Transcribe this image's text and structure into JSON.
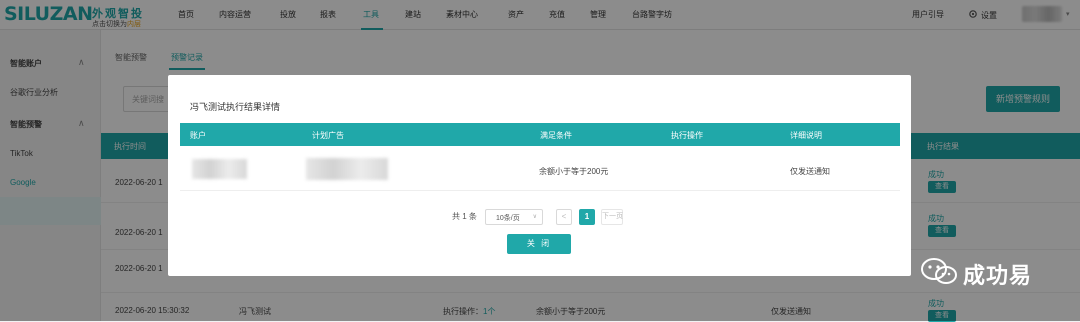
{
  "brand": {
    "logo": "SILUZAN",
    "logo_cn": "外观智投",
    "sub_prefix": "点击切换为",
    "sub_highlight": "内层"
  },
  "nav": {
    "items": [
      "首页",
      "内容运营",
      "投放",
      "报表",
      "工具",
      "建站",
      "素材中心",
      "资产",
      "充值",
      "管理",
      "台路警字坊"
    ],
    "active_index": 4
  },
  "top_right": {
    "guide": "用户引导",
    "settings": "设置"
  },
  "sidebar": {
    "items": [
      {
        "label": "智能账户",
        "group": true,
        "caret": "∧"
      },
      {
        "label": "谷歌行业分析",
        "group": false
      },
      {
        "label": "智能预警",
        "group": true,
        "caret": "∧"
      },
      {
        "label": "TikTok",
        "group": false
      },
      {
        "label": "Google",
        "group": false,
        "active": true
      }
    ]
  },
  "subtabs": {
    "items": [
      "智能预警",
      "预警记录"
    ],
    "active_index": 1
  },
  "search": {
    "placeholder": "关键词搜"
  },
  "new_rule_button": "新增预警规则",
  "bg_table": {
    "headers": [
      "执行时间",
      "执行结果"
    ],
    "rows": [
      {
        "time": "2022-06-20 1",
        "status": "成功",
        "view": "查看"
      },
      {
        "time": "2022-06-20 1",
        "status": "成功",
        "view": "查看"
      },
      {
        "time": "2022-06-20 1",
        "status": "",
        "view": ""
      },
      {
        "time": "2022-06-20 15:30:32",
        "name": "冯飞测试",
        "op_label": "执行操作：",
        "op_count": "1个",
        "condition": "余额小于等于200元",
        "detail": "仅发送通知",
        "status": "成功",
        "view": "查看"
      }
    ]
  },
  "modal": {
    "title": "冯飞测试执行结果详情",
    "headers": [
      "账户",
      "计划广告",
      "满足条件",
      "执行操作",
      "详细说明"
    ],
    "rows": [
      {
        "account": "",
        "plan": "",
        "condition": "余额小于等于200元",
        "operation": "",
        "detail": "仅发送通知"
      }
    ],
    "pagination": {
      "total": "共 1 条",
      "page_size": "10条/页",
      "prev": "<",
      "current": "1",
      "next": "下一页"
    },
    "close_button": "关 闭"
  },
  "watermark": {
    "text": "成功易",
    "icon": "wechat-icon"
  },
  "colors": {
    "accent": "#20a8a9",
    "highlight": "#e8a317"
  }
}
